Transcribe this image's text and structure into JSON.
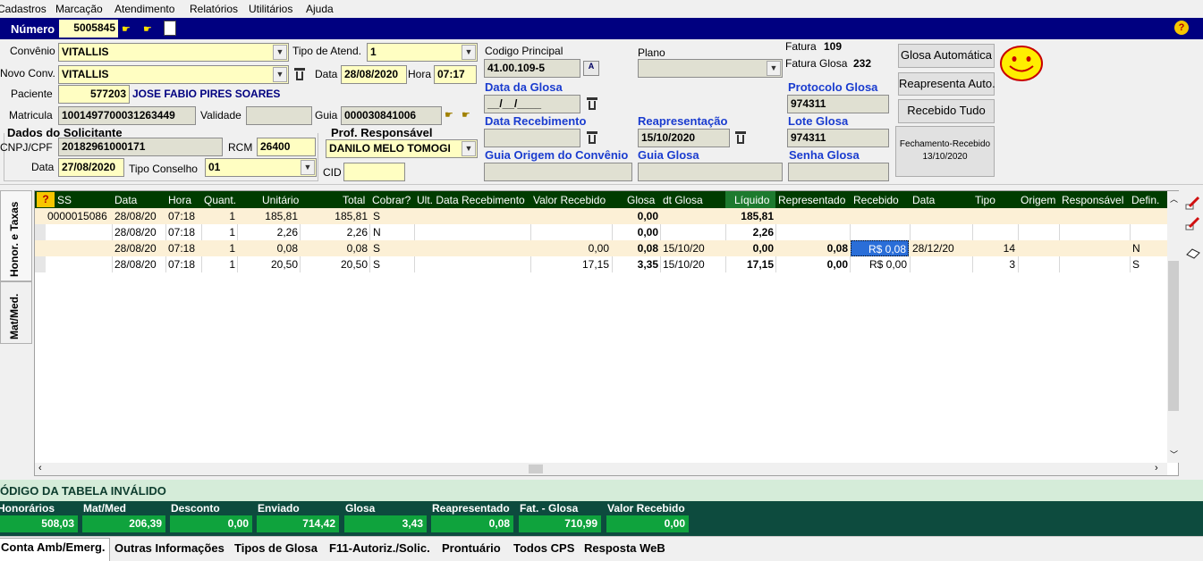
{
  "menu": [
    "Cadastros",
    "Marcação",
    "Atendimento",
    "Relatórios",
    "Utilitários",
    "Ajuda"
  ],
  "numero": {
    "label": "Número",
    "value": "5005845"
  },
  "form": {
    "convenio_label": "Convênio",
    "convenio_value": "VITALLIS",
    "tipo_atend_label": "Tipo de Atend.",
    "tipo_atend_value": "1",
    "novo_conv_label": "Novo Conv.",
    "novo_conv_value": "VITALLIS",
    "data_label": "Data",
    "data_value": "28/08/2020",
    "hora_label": "Hora",
    "hora_value": "07:17",
    "paciente_label": "Paciente",
    "paciente_code": "577203",
    "paciente_name": "JOSE FABIO PIRES SOARES",
    "matricula_label": "Matricula",
    "matricula_value": "1001497700031263449",
    "validade_label": "Validade",
    "validade_value": "",
    "guia_label": "Guia",
    "guia_value": "000030841006",
    "solicitante_title": "Dados do Solicitante",
    "cnpj_label": "CNPJ/CPF",
    "cnpj_value": "20182961000171",
    "rcm_label": "RCM",
    "rcm_value": "26400",
    "data2_label": "Data",
    "data2_value": "27/08/2020",
    "tipo_conselho_label": "Tipo Conselho",
    "tipo_conselho_value": "01",
    "prof_title": "Prof. Responsável",
    "prof_value": "DANILO MELO TOMOGI",
    "cid_label": "CID",
    "cid_value": ""
  },
  "glosa": {
    "codigo_label": "Codigo Principal",
    "codigo_value": "41.00.109-5",
    "plano_label": "Plano",
    "plano_value": "",
    "fatura_label": "Fatura",
    "fatura_value": "109",
    "fatura_glosa_label": "Fatura Glosa",
    "fatura_glosa_value": "232",
    "data_glosa_label": "Data da Glosa",
    "data_glosa_value": "__/__/____",
    "protocolo_label": "Protocolo Glosa",
    "protocolo_value": "974311",
    "data_receb_label": "Data Recebimento",
    "data_receb_value": "",
    "reapres_label": "Reapresentação",
    "reapres_value": "15/10/2020",
    "lote_label": "Lote Glosa",
    "lote_value": "974311",
    "guia_origem_label": "Guia Origem do Convênio",
    "guia_origem_value": "",
    "guia_glosa_label": "Guia Glosa",
    "guia_glosa_value": "",
    "senha_label": "Senha Glosa",
    "senha_value": ""
  },
  "buttons": {
    "glosa_auto": "Glosa Automática",
    "reapresenta": "Reapresenta Auto.",
    "recebido_tudo": "Recebido Tudo",
    "fechamento_line1": "Fechamento-Recebido",
    "fechamento_line2": "13/10/2020"
  },
  "side_tabs": [
    "Honor. e Taxas",
    "Mat/Med."
  ],
  "grid": {
    "help": "?",
    "headers": [
      "SS",
      "Data",
      "Hora",
      "Quant.",
      "Unitário",
      "Total",
      "Cobrar?",
      "Ult. Data Recebimento",
      "Valor Recebido",
      "Glosa",
      "dt Glosa",
      "Líquido",
      "Representado",
      "Recebido",
      "Data",
      "Tipo",
      "Origem",
      "Responsável",
      "Defin."
    ],
    "rows": [
      {
        "ss": "0000015086",
        "data": "28/08/20",
        "hora": "07:18",
        "quant": "1",
        "unit": "185,81",
        "total": "185,81",
        "cobrar": "S",
        "ult": "",
        "valrec": "",
        "glosa": "0,00",
        "dtglosa": "",
        "liquido": "185,81",
        "repr": "",
        "receb": "",
        "data2": "",
        "tipo": "",
        "origem": "",
        "resp": "",
        "defin": ""
      },
      {
        "ss": "",
        "data": "28/08/20",
        "hora": "07:18",
        "quant": "1",
        "unit": "2,26",
        "total": "2,26",
        "cobrar": "N",
        "ult": "",
        "valrec": "",
        "glosa": "0,00",
        "dtglosa": "",
        "liquido": "2,26",
        "repr": "",
        "receb": "",
        "data2": "",
        "tipo": "",
        "origem": "",
        "resp": "",
        "defin": ""
      },
      {
        "ss": "",
        "data": "28/08/20",
        "hora": "07:18",
        "quant": "1",
        "unit": "0,08",
        "total": "0,08",
        "cobrar": "S",
        "ult": "",
        "valrec": "0,00",
        "glosa": "0,08",
        "dtglosa": "15/10/20",
        "liquido": "0,00",
        "repr": "0,08",
        "receb": "R$ 0,08",
        "data2": "28/12/20",
        "tipo": "14",
        "origem": "",
        "resp": "",
        "defin": "N"
      },
      {
        "ss": "",
        "data": "28/08/20",
        "hora": "07:18",
        "quant": "1",
        "unit": "20,50",
        "total": "20,50",
        "cobrar": "S",
        "ult": "",
        "valrec": "17,15",
        "glosa": "3,35",
        "dtglosa": "15/10/20",
        "liquido": "17,15",
        "repr": "0,00",
        "receb": "R$ 0,00",
        "data2": "",
        "tipo": "3",
        "origem": "",
        "resp": "",
        "defin": "S"
      }
    ]
  },
  "status_message": "ÓDIGO DA TABELA INVÁLIDO",
  "totals": [
    {
      "label": "Honorários",
      "value": "508,03"
    },
    {
      "label": "Mat/Med",
      "value": "206,39"
    },
    {
      "label": "Desconto",
      "value": "0,00"
    },
    {
      "label": "Enviado",
      "value": "714,42"
    },
    {
      "label": "Glosa",
      "value": "3,43"
    },
    {
      "label": "Reapresentado",
      "value": "0,08"
    },
    {
      "label": "Fat. - Glosa",
      "value": "710,99"
    },
    {
      "label": "Valor Recebido",
      "value": "0,00"
    }
  ],
  "bottom_tabs": [
    "Conta Amb/Emerg.",
    "Outras Informações",
    "Tipos de Glosa",
    "F11-Autoriz./Solic.",
    "Prontuário",
    "Todos CPS",
    "Resposta WeB"
  ],
  "colors": {
    "title_bar": "#000080",
    "field_yellow": "#fffec2",
    "grid_header": "#003c00",
    "totals_bar": "#0d4b3e",
    "totals_value": "#0fa33d",
    "link_blue": "#1a3ccf"
  }
}
